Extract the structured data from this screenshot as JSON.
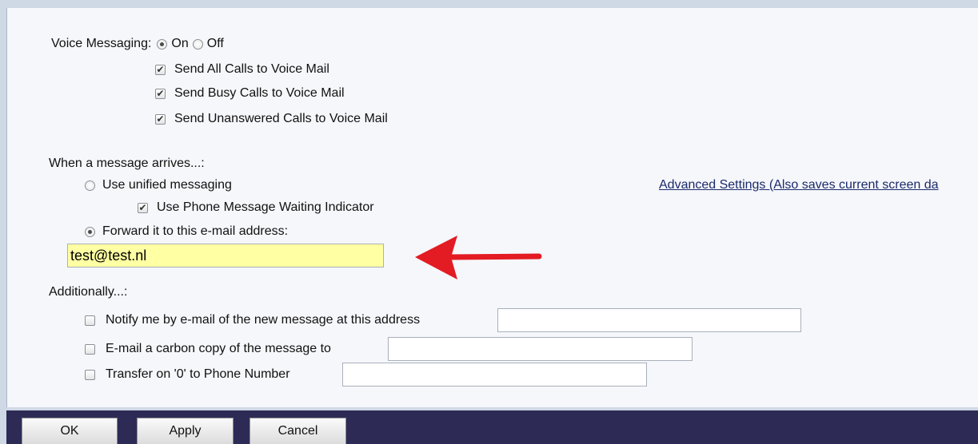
{
  "voice_messaging": {
    "label": "Voice Messaging:",
    "on_label": "On",
    "off_label": "Off",
    "selected": "On",
    "options": [
      {
        "label": "Send All Calls to Voice Mail",
        "checked": true
      },
      {
        "label": "Send Busy Calls to Voice Mail",
        "checked": true
      },
      {
        "label": "Send Unanswered Calls to Voice Mail",
        "checked": true
      }
    ]
  },
  "message_arrives": {
    "label": "When a message arrives...:",
    "unified_label": "Use unified messaging",
    "mwi_label": "Use Phone Message Waiting Indicator",
    "forward_label": "Forward it to this e-mail address:",
    "selected": "Forward it to this e-mail address:",
    "email_value": "test@test.nl",
    "advanced_link": "Advanced Settings (Also saves current screen da"
  },
  "additionally": {
    "label": "Additionally...:",
    "options": [
      {
        "label": "Notify me by e-mail of the new message at this address",
        "checked": false,
        "value": ""
      },
      {
        "label": "E-mail a carbon copy of the message to",
        "checked": false,
        "value": ""
      },
      {
        "label": "Transfer on '0' to Phone Number",
        "checked": false,
        "value": ""
      }
    ]
  },
  "buttons": {
    "ok": "OK",
    "apply": "Apply",
    "cancel": "Cancel"
  },
  "annotation": {
    "arrow_color": "#e31b23"
  }
}
